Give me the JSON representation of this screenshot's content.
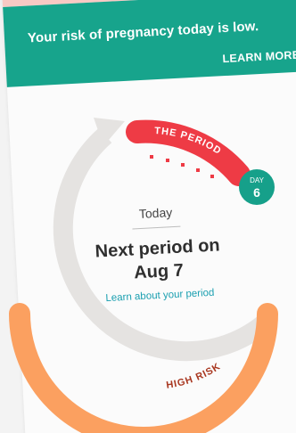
{
  "banner": {
    "message": "Your risk of pregnancy today is low.",
    "learn_more_label": "LEARN MORE"
  },
  "cycle": {
    "period_label": "THE PERIOD",
    "high_risk_label": "HIGH RISK",
    "day_label": "DAY",
    "day_number": "6",
    "today_label": "Today",
    "next_period_line1": "Next period on",
    "next_period_line2": "Aug 7",
    "learn_period_link": "Learn about your period"
  },
  "colors": {
    "banner": "#17a48c",
    "period": "#ee3b45",
    "high_risk": "#fba060",
    "track": "#e5e3e1",
    "day_badge": "#16a08a",
    "link": "#1a9fb0"
  }
}
